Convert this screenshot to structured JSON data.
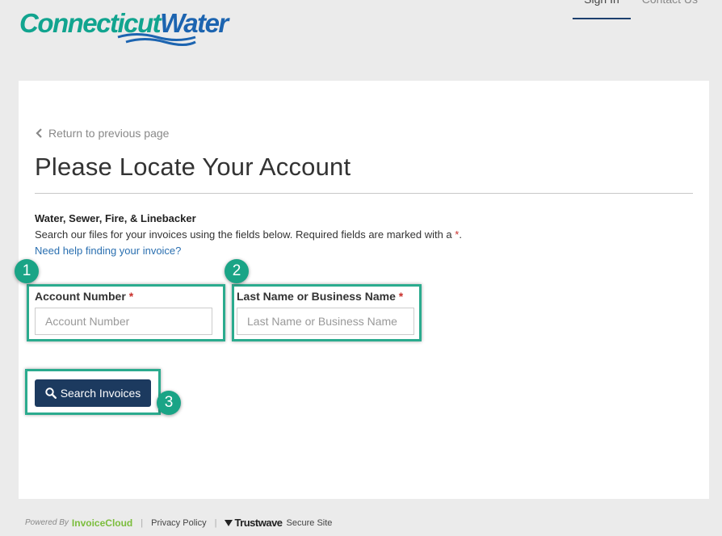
{
  "brand": {
    "word1": "Connecticut",
    "word2": "Water"
  },
  "nav": {
    "signin": "Sign In",
    "contact": "Contact Us"
  },
  "page": {
    "back_link": "Return to previous page",
    "title": "Please Locate Your Account",
    "subheading": "Water, Sewer, Fire, & Linebacker",
    "description": "Search our files for your invoices using the fields below.  Required fields are marked with a ",
    "required_mark": "*",
    "description_end": ".",
    "help_link": "Need help finding your invoice?"
  },
  "form": {
    "account_label": "Account Number",
    "account_placeholder": "Account Number",
    "account_value": "",
    "name_label": "Last Name or Business Name",
    "name_placeholder": "Last Name or Business Name",
    "name_value": "",
    "search_label": "Search Invoices"
  },
  "badges": {
    "one": "1",
    "two": "2",
    "three": "3"
  },
  "footer": {
    "powered": "Powered By",
    "brand": "InvoiceCloud",
    "sep": "|",
    "privacy": "Privacy Policy",
    "trust": "Trustwave",
    "secure": "Secure Site"
  },
  "icons": {
    "back": "chevron-left-icon",
    "search": "search-icon"
  },
  "colors": {
    "accent": "#2bab8e",
    "button": "#1c3a5f",
    "link": "#2a6fb0",
    "required": "#c9302c"
  }
}
